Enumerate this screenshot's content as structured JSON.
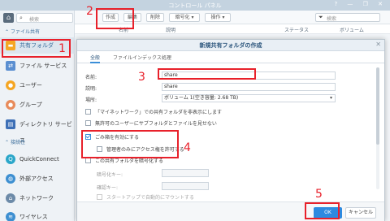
{
  "window": {
    "title": "コントロール パネル",
    "controls": "? — ❐ ✕"
  },
  "sidebar": {
    "search_placeholder": "検索",
    "section_file_sharing": "ファイル共有",
    "section_connectivity": "接続性",
    "items": [
      {
        "label": "共有フォルダ",
        "icon": "folder-icon",
        "color": "#f5a623"
      },
      {
        "label": "ファイル サービス",
        "icon": "file-services-icon",
        "color": "#5b8fd1"
      },
      {
        "label": "ユーザー",
        "icon": "user-icon",
        "color": "#f5a623"
      },
      {
        "label": "グループ",
        "icon": "group-icon",
        "color": "#e88b5b"
      },
      {
        "label": "ディレクトリ サービス",
        "icon": "directory-icon",
        "color": "#3d6fb6"
      },
      {
        "label": "QuickConnect",
        "icon": "quickconnect-icon",
        "color": "#2aa6c9"
      },
      {
        "label": "外部アクセス",
        "icon": "globe-icon",
        "color": "#3d8fd1"
      },
      {
        "label": "ネットワーク",
        "icon": "network-icon",
        "color": "#6c8aa8"
      },
      {
        "label": "ワイヤレス",
        "icon": "wifi-icon",
        "color": "#3d8fd1"
      }
    ]
  },
  "toolbar": {
    "create": "作成",
    "edit": "編集",
    "delete": "削除",
    "encrypt": "暗号化 ▾",
    "action": "操作 ▾",
    "filter_placeholder": "検索"
  },
  "columns": {
    "name": "名前",
    "description": "説明",
    "status": "ステータス",
    "volume": "ボリューム"
  },
  "dialog": {
    "title": "新規共有フォルダの作成",
    "close": "✕",
    "tabs": [
      "全般",
      "ファイルインデックス処理"
    ],
    "name_label": "名前:",
    "name_value": "share",
    "desc_label": "説明:",
    "desc_value": "share",
    "location_label": "場所:",
    "location_value": "ボリューム 1(空き容量: 2.68 TB)",
    "opt_hide_network": "「マイネットワーク」での共有フォルダを非表示にします",
    "opt_hide_unauth": "無許可のユーザーにサブフォルダとファイルを見せない",
    "opt_recycle": "ごみ箱を有効にする",
    "opt_admin_only": "管理者のみにアクセス権を許可する",
    "opt_encrypt": "この共有フォルダを暗号化する",
    "enc_key_label": "暗号化キー:",
    "confirm_key_label": "確認キー:",
    "opt_automount": "スタートアップで自動的にマウントする",
    "ok": "OK",
    "cancel": "キャンセル"
  },
  "annotations": [
    "1",
    "2",
    "3",
    "4",
    "5"
  ],
  "colors": {
    "accent": "#2d8ae0",
    "annotation": "#e8212b"
  }
}
